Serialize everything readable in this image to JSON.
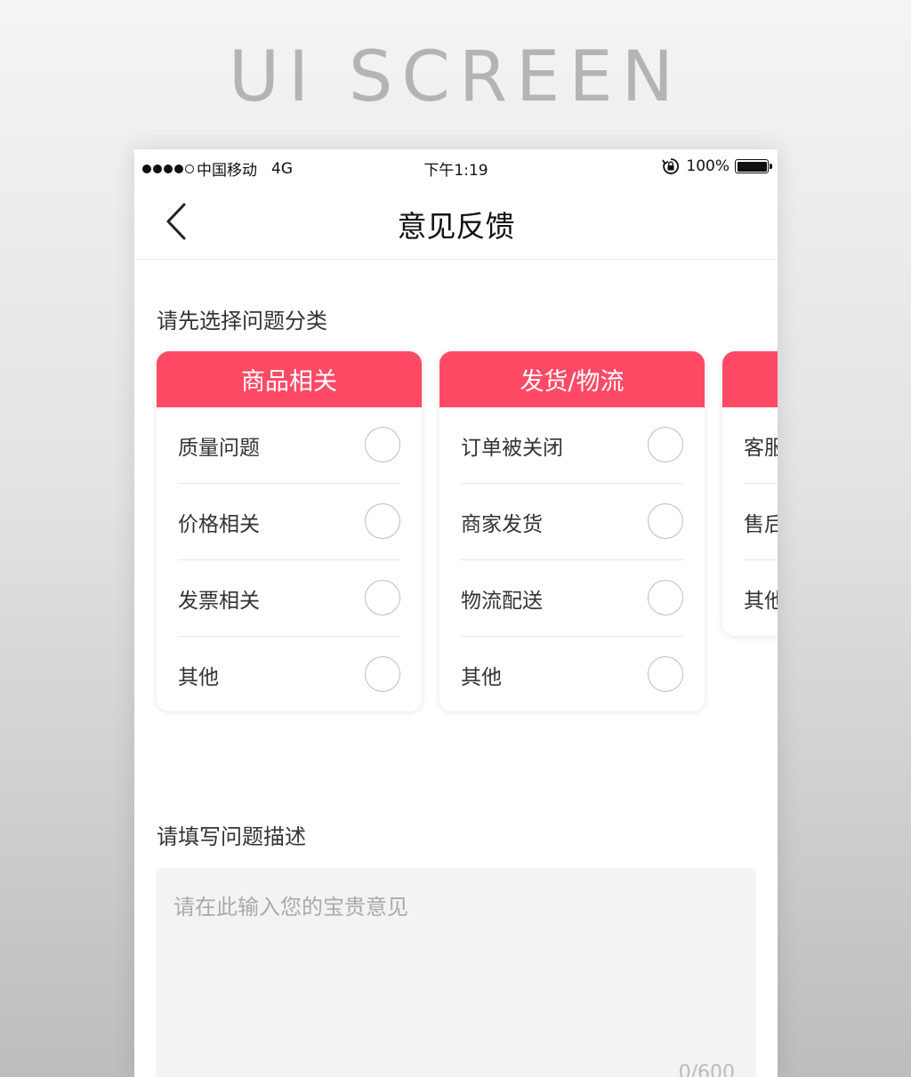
{
  "banner": {
    "text": "UI SCREEN"
  },
  "status_bar": {
    "carrier": "中国移动",
    "network": "4G",
    "time": "下午1:19",
    "battery_percent": "100%",
    "signal_bars_filled": 4,
    "signal_bars_total": 5,
    "battery_level": 1.0
  },
  "nav": {
    "title": "意见反馈",
    "back_icon": "chevron-left-icon"
  },
  "category_section": {
    "label": "请先选择问题分类",
    "cards": [
      {
        "title": "商品相关",
        "options": [
          "质量问题",
          "价格相关",
          "发票相关",
          "其他"
        ]
      },
      {
        "title": "发货/物流",
        "options": [
          "订单被关闭",
          "商家发货",
          "物流配送",
          "其他"
        ]
      },
      {
        "title": "",
        "options": [
          "客服",
          "售后",
          "其他"
        ]
      }
    ]
  },
  "description_section": {
    "label": "请填写问题描述",
    "placeholder": "请在此输入您的宝贵意见",
    "counter": "0/600"
  },
  "colors": {
    "accent": "#fe4a65",
    "text": "#333333",
    "placeholder": "#aaaaaa",
    "input_bg": "#f2f3f5"
  }
}
